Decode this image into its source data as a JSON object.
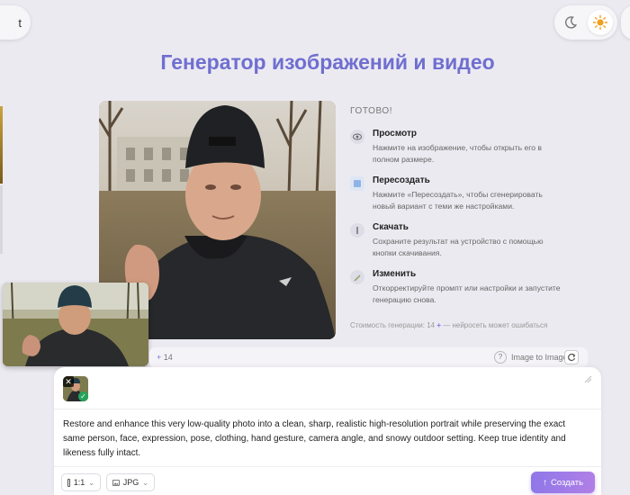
{
  "nav": {
    "left_pill_text": "t"
  },
  "page_title": "Генератор изображений и видео",
  "info_panel": {
    "ready_label": "ГОТОВО!",
    "steps": [
      {
        "icon": "eye-icon",
        "title": "Просмотр",
        "desc": "Нажмите на изображение, чтобы открыть его в полном размере."
      },
      {
        "icon": "regenerate-icon",
        "title": "Пересоздать",
        "desc": "Нажмите «Пересоздать», чтобы сгенерировать новый вариант с теми же настройками."
      },
      {
        "icon": "download-icon",
        "title": "Скачать",
        "desc": "Сохраните результат на устройство с помощью кнопки скачивания."
      },
      {
        "icon": "pencil-icon",
        "title": "Изменить",
        "desc": "Откорректируйте промпт или настройки и запустите генерацию снова."
      }
    ],
    "cost_prefix": "Стоимость генерации: 14",
    "cost_suffix": "— нейросеть может ошибаться"
  },
  "sub_bar": {
    "count": "14",
    "help": "?",
    "mode": "Image to Image"
  },
  "composer": {
    "prompt": "Restore and enhance this very low-quality photo into a clean, sharp, realistic high-resolution portrait while preserving the exact same person, face, expression, pose, clothing, hand gesture, camera angle, and snowy outdoor setting. Keep true identity and likeness fully intact.",
    "ratio": "1:1",
    "format": "JPG",
    "create_label": "Создать"
  },
  "colors": {
    "accent": "#6f6fd0",
    "button_start": "#8f77e8",
    "button_end": "#b07fe6"
  }
}
